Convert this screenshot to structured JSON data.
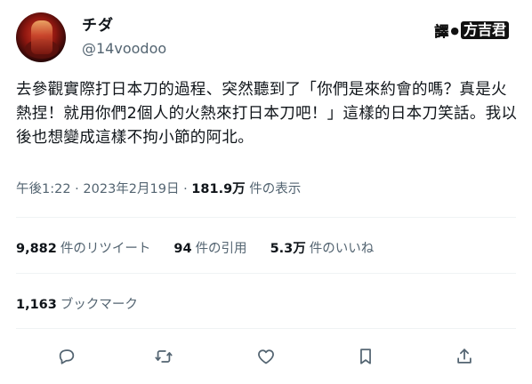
{
  "user": {
    "display_name": "チダ",
    "handle": "@14voodoo"
  },
  "watermark": {
    "prefix": "譯",
    "dot": "●",
    "name": "方吉君"
  },
  "tweet": {
    "text": "去參觀實際打日本刀的過程、突然聽到了「你們是來約會的嗎？真是火熱捏！就用你們2個人的火熱來打日本刀吧！」這樣的日本刀笑話。我以後也想變成這樣不拘小節的阿北。",
    "time": "午後1:22",
    "separator": "·",
    "date": "2023年2月19日",
    "views_count": "181.9万",
    "views_label": "件の表示"
  },
  "stats": {
    "retweets_count": "9,882",
    "retweets_label": "件のリツイート",
    "quotes_count": "94",
    "quotes_label": "件の引用",
    "likes_count": "5.3万",
    "likes_label": "件のいいね",
    "bookmarks_count": "1,163",
    "bookmarks_label": "ブックマーク"
  },
  "actions": {
    "reply_icon": "reply-icon",
    "retweet_icon": "retweet-icon",
    "like_icon": "heart-icon",
    "bookmark_icon": "bookmark-icon",
    "share_icon": "share-icon",
    "icon_color": "#536471"
  },
  "colors": {
    "text": "#0f1419",
    "secondary": "#536471",
    "divider": "#eff3f4"
  }
}
